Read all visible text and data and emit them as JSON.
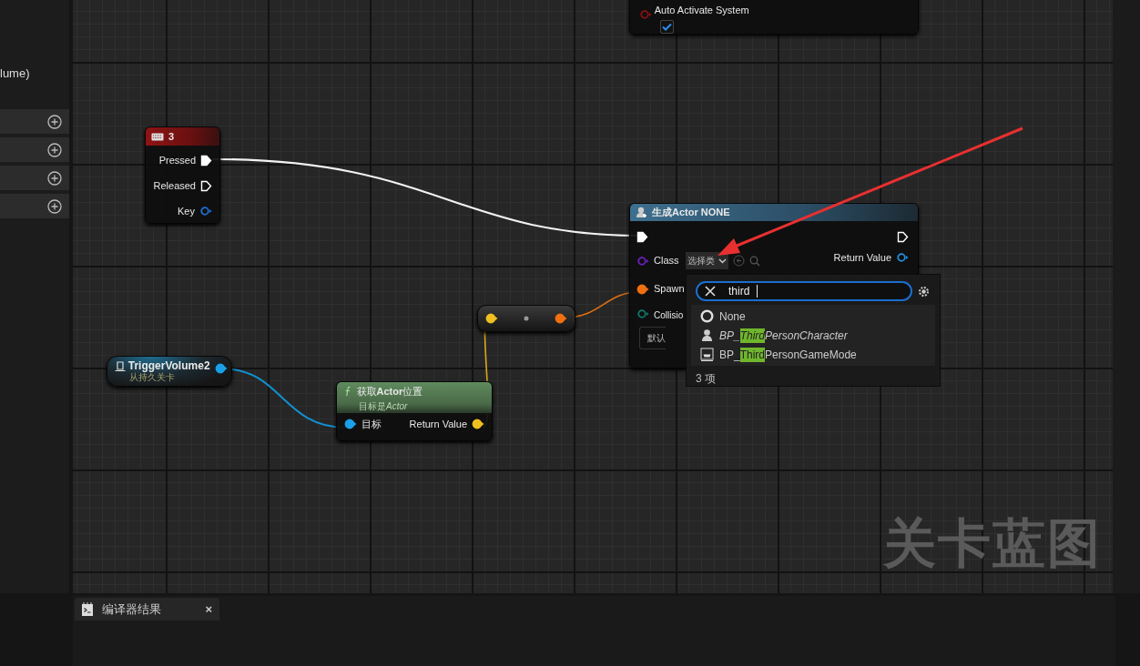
{
  "left_panel": {
    "cut_text": "lume)"
  },
  "nodes": [
    {
      "kind": "fragment",
      "pins": [
        {
          "kind": "data",
          "label": "Auto Activate System",
          "connected": false,
          "color": "#8a1010"
        }
      ],
      "checked": true
    },
    {
      "kind": "key_event",
      "title": "3",
      "pins": [
        {
          "kind": "exec",
          "label": "Pressed",
          "connected": true,
          "color": "#ffffff"
        },
        {
          "kind": "exec",
          "label": "Released",
          "connected": false,
          "color": "#ffffff"
        },
        {
          "kind": "data",
          "label": "Key",
          "connected": false,
          "color": "#1f6fd6"
        }
      ]
    },
    {
      "kind": "spawn",
      "title": "生成Actor NONE",
      "pins": [
        {
          "kind": "exec",
          "connected": true,
          "color": "#ffffff"
        },
        {
          "kind": "data",
          "label": "Class",
          "connected": false,
          "color": "#6a1fc0"
        },
        {
          "kind": "data",
          "label": "Spawn",
          "connected": true,
          "color": "#f07010"
        },
        {
          "kind": "data",
          "label": "Collisio",
          "connected": false,
          "color": "#0e7a6a"
        }
      ],
      "outputs": [
        {
          "kind": "exec",
          "connected": false,
          "color": "#ffffff"
        },
        {
          "kind": "data",
          "label": "Return Value",
          "connected": false,
          "color": "#1f8fe0"
        }
      ],
      "class_value": "选择类",
      "collision_value": "默认"
    },
    {
      "kind": "reroute",
      "pins": [
        {
          "kind": "data",
          "connected": true,
          "color": "#f0c020"
        },
        {
          "kind": "data",
          "connected": true,
          "color": "#f07010"
        }
      ]
    },
    {
      "kind": "actor_ref",
      "title": "TriggerVolume2",
      "subtitle": "从持久关卡",
      "pins": [
        {
          "kind": "data",
          "connected": true,
          "color": "#1aa0e8"
        }
      ]
    },
    {
      "kind": "function",
      "title": "获取**Actor**位置",
      "subtitle": "目标是",
      "subtitle_italic": "Actor",
      "pins": [
        {
          "kind": "data",
          "label": "目标",
          "connected": true,
          "color": "#1aa0e8"
        }
      ],
      "outputs": [
        {
          "kind": "data",
          "label": "Return Value",
          "connected": true,
          "color": "#f0c020"
        }
      ]
    }
  ],
  "class_picker": {
    "search": "third",
    "items": [
      {
        "kind": "none",
        "label": "None",
        "selected": false
      },
      {
        "kind": "character",
        "prefix": "BP_",
        "match": "Third",
        "rest": "PersonCharacter",
        "italic": true,
        "selected": false
      },
      {
        "kind": "game_mode",
        "prefix": "BP_",
        "match": "Third",
        "rest": "PersonGameMode",
        "italic": false,
        "selected": false
      }
    ],
    "count": "3 项"
  },
  "graph_watermark": "关卡蓝图",
  "bottom_panel": {
    "tabs": [
      {
        "label": "编译器结果",
        "selected": true,
        "close": "×"
      }
    ]
  }
}
